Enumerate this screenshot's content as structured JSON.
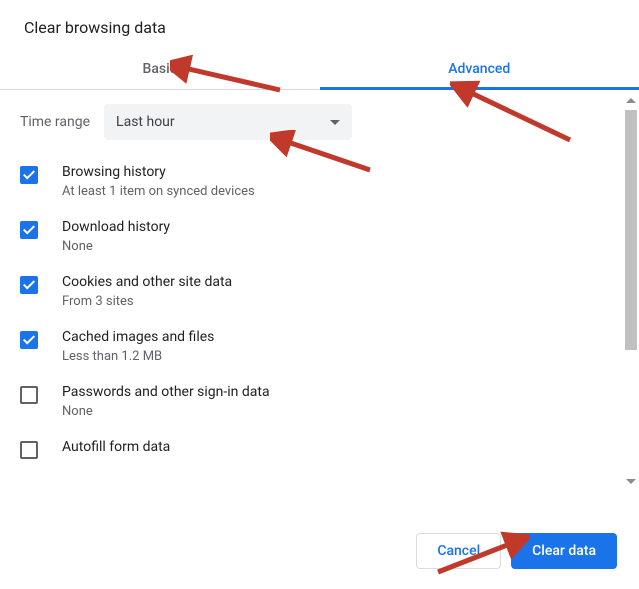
{
  "title": "Clear browsing data",
  "tabs": {
    "basic": "Basic",
    "advanced": "Advanced",
    "active": "advanced"
  },
  "range": {
    "label": "Time range",
    "value": "Last hour"
  },
  "items": [
    {
      "checked": true,
      "title": "Browsing history",
      "sub": "At least 1 item on synced devices"
    },
    {
      "checked": true,
      "title": "Download history",
      "sub": "None"
    },
    {
      "checked": true,
      "title": "Cookies and other site data",
      "sub": "From 3 sites"
    },
    {
      "checked": true,
      "title": "Cached images and files",
      "sub": "Less than 1.2 MB"
    },
    {
      "checked": false,
      "title": "Passwords and other sign-in data",
      "sub": "None"
    },
    {
      "checked": false,
      "title": "Autofill form data",
      "sub": ""
    }
  ],
  "buttons": {
    "cancel": "Cancel",
    "clear": "Clear data"
  }
}
